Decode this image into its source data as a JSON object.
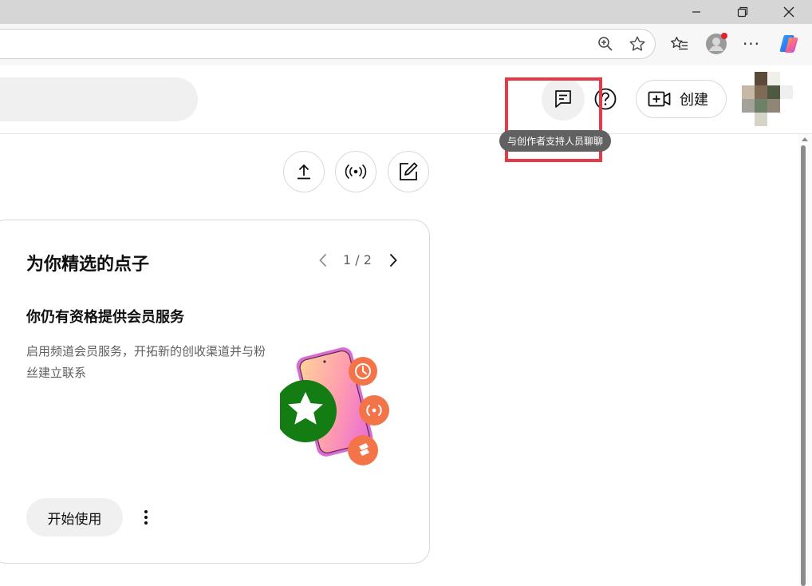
{
  "browser": {
    "window_controls": [
      "minimize",
      "restore",
      "close"
    ],
    "toolbar_icons": [
      "zoom-icon",
      "favorite-star-icon",
      "favorites-list-icon",
      "profile-icon",
      "more-icon",
      "copilot-icon"
    ],
    "more_label": "···"
  },
  "header": {
    "search_placeholder": "",
    "chat_icon": "chat-support-icon",
    "help_icon": "help-icon",
    "create_label": "创建",
    "tooltip": "与创作者支持人员聊聊"
  },
  "actions": [
    "upload-icon",
    "live-icon",
    "post-edit-icon"
  ],
  "ideas_card": {
    "title": "为你精选的点子",
    "pager": "1 / 2",
    "idea_title": "你仍有资格提供会员服务",
    "idea_description": "启用频道会员服务，开拓新的创收渠道并与粉丝建立联系",
    "start_button": "开始使用",
    "more_icon": "more-vert-icon"
  },
  "colors": {
    "highlight": "#e63946",
    "star_badge": "#137d13",
    "orange_badge": "#f4744a",
    "tooltip_bg": "#616161"
  }
}
